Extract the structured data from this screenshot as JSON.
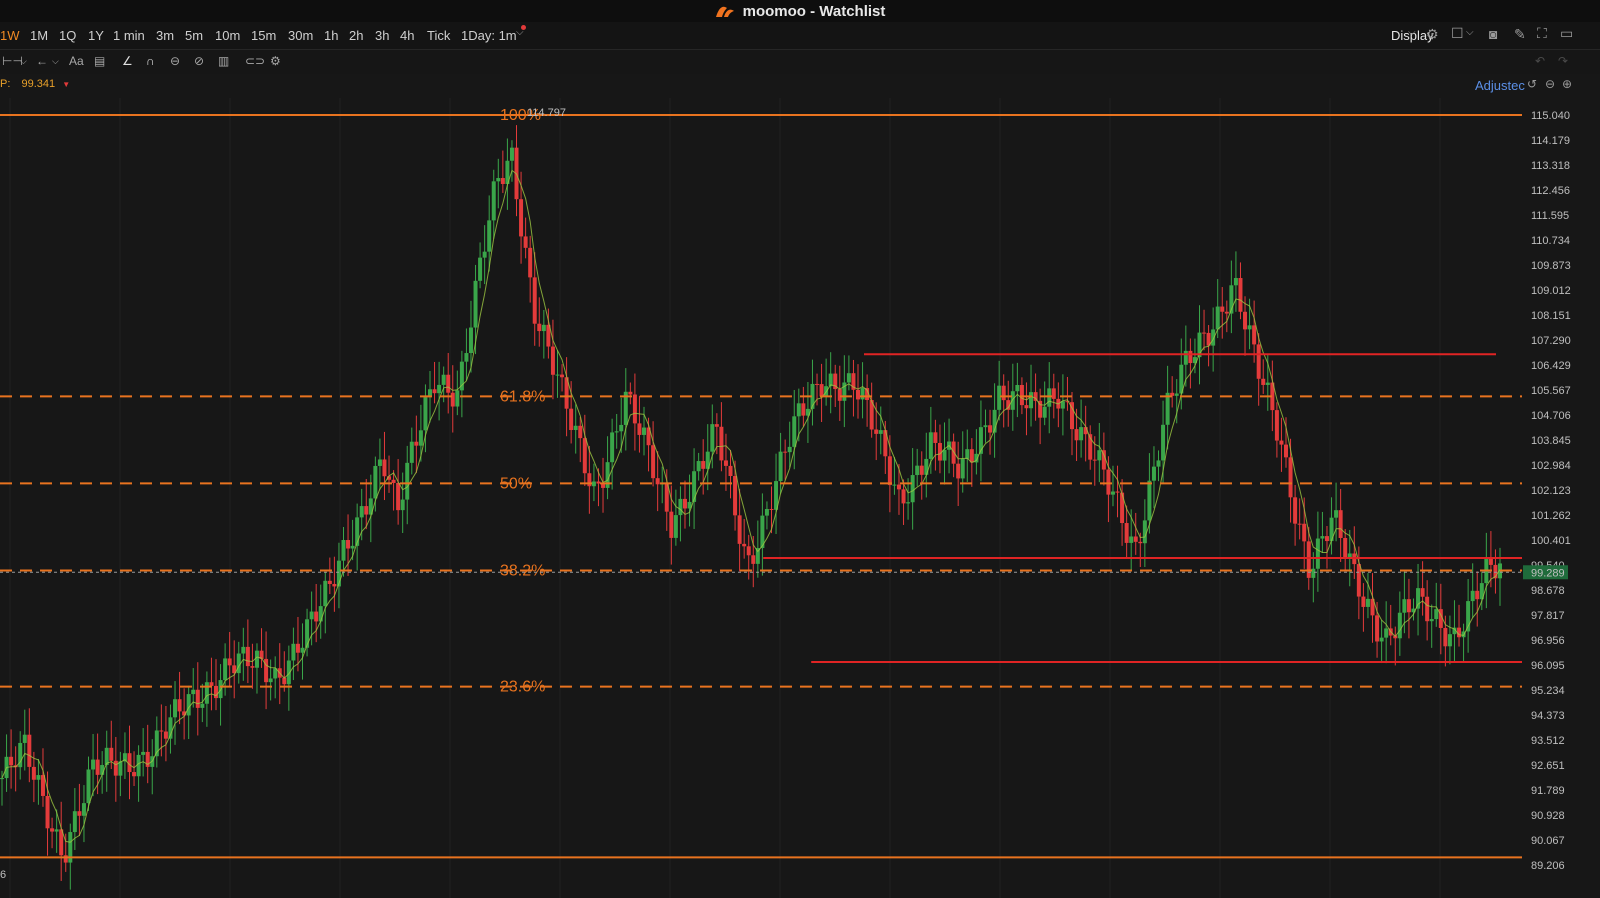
{
  "window": {
    "title": "moomoo - Watchlist",
    "logo_icon": "moomoo-logo-icon"
  },
  "timeframes": [
    {
      "label": "1W",
      "active": true
    },
    {
      "label": "1M"
    },
    {
      "label": "1Q"
    },
    {
      "label": "1Y"
    },
    {
      "label": "1 min"
    },
    {
      "label": "3m"
    },
    {
      "label": "5m"
    },
    {
      "label": "10m"
    },
    {
      "label": "15m"
    },
    {
      "label": "30m"
    },
    {
      "label": "1h"
    },
    {
      "label": "2h"
    },
    {
      "label": "3h"
    },
    {
      "label": "4h"
    },
    {
      "label": "Tick"
    },
    {
      "label": "1Day: 1m"
    }
  ],
  "toolbar": {
    "display_label": "Display",
    "adjusted_label": "Adjustec"
  },
  "price_info": {
    "label": "P:",
    "value": "99.341",
    "arrow": "▼"
  },
  "colors": {
    "accent": "#f08a24",
    "fib": "#e8731f",
    "resistance": "#e02424",
    "up": "#3aa64a",
    "down": "#e33b3b",
    "ma": "#9ec842"
  },
  "chart_data": {
    "type": "candlestick",
    "y_axis": {
      "range": [
        88.8,
        115.6
      ],
      "ticks": [
        "115.040",
        "114.179",
        "113.318",
        "112.456",
        "111.595",
        "110.734",
        "109.873",
        "109.012",
        "108.151",
        "107.290",
        "106.429",
        "105.567",
        "104.706",
        "103.845",
        "102.984",
        "102.123",
        "101.262",
        "100.401",
        "99.540",
        "98.678",
        "97.817",
        "96.956",
        "96.095",
        "95.234",
        "94.373",
        "93.512",
        "92.651",
        "91.789",
        "90.928",
        "90.067",
        "89.206"
      ]
    },
    "high_label": "114.797",
    "current_price": "99.289",
    "fib_levels": [
      {
        "label": "100%",
        "value": 115.04
      },
      {
        "label": "61.8%",
        "value": 105.35
      },
      {
        "label": "50%",
        "value": 102.35
      },
      {
        "label": "38.2%",
        "value": 99.35
      },
      {
        "label": "23.6%",
        "value": 95.35
      },
      {
        "label": "",
        "value": 89.47
      }
    ],
    "horizontal_lines": [
      {
        "value": 106.8,
        "x_from": 0.54,
        "x_to": 0.935
      },
      {
        "value": 99.78,
        "x_from": 0.477,
        "x_to": 0.988
      },
      {
        "value": 96.2,
        "x_from": 0.507,
        "x_to": 0.958
      }
    ],
    "waypoints": [
      [
        0,
        92.2
      ],
      [
        0.015,
        93.0
      ],
      [
        0.04,
        89.8
      ],
      [
        0.06,
        92.3
      ],
      [
        0.1,
        93.3
      ],
      [
        0.12,
        94.5
      ],
      [
        0.15,
        96.3
      ],
      [
        0.18,
        95.6
      ],
      [
        0.195,
        97.1
      ],
      [
        0.215,
        98.4
      ],
      [
        0.25,
        103.5
      ],
      [
        0.26,
        101.2
      ],
      [
        0.285,
        106.2
      ],
      [
        0.3,
        105.6
      ],
      [
        0.325,
        112.5
      ],
      [
        0.335,
        113.8
      ],
      [
        0.35,
        108.5
      ],
      [
        0.37,
        104.9
      ],
      [
        0.39,
        102.2
      ],
      [
        0.41,
        105.2
      ],
      [
        0.44,
        101.2
      ],
      [
        0.47,
        103.9
      ],
      [
        0.49,
        99.7
      ],
      [
        0.52,
        104.0
      ],
      [
        0.54,
        106.1
      ],
      [
        0.56,
        105.8
      ],
      [
        0.59,
        101.9
      ],
      [
        0.61,
        103.7
      ],
      [
        0.63,
        102.6
      ],
      [
        0.655,
        105.5
      ],
      [
        0.68,
        104.7
      ],
      [
        0.695,
        105.7
      ],
      [
        0.72,
        102.9
      ],
      [
        0.745,
        100.2
      ],
      [
        0.765,
        104.7
      ],
      [
        0.78,
        106.4
      ],
      [
        0.81,
        109.4
      ],
      [
        0.825,
        106.2
      ],
      [
        0.84,
        104.0
      ],
      [
        0.86,
        99.5
      ],
      [
        0.875,
        100.9
      ],
      [
        0.89,
        99.1
      ],
      [
        0.91,
        97.1
      ],
      [
        0.93,
        98.1
      ],
      [
        0.955,
        97.3
      ],
      [
        0.975,
        99.0
      ],
      [
        0.985,
        99.3
      ]
    ]
  },
  "bottom_label": "6"
}
